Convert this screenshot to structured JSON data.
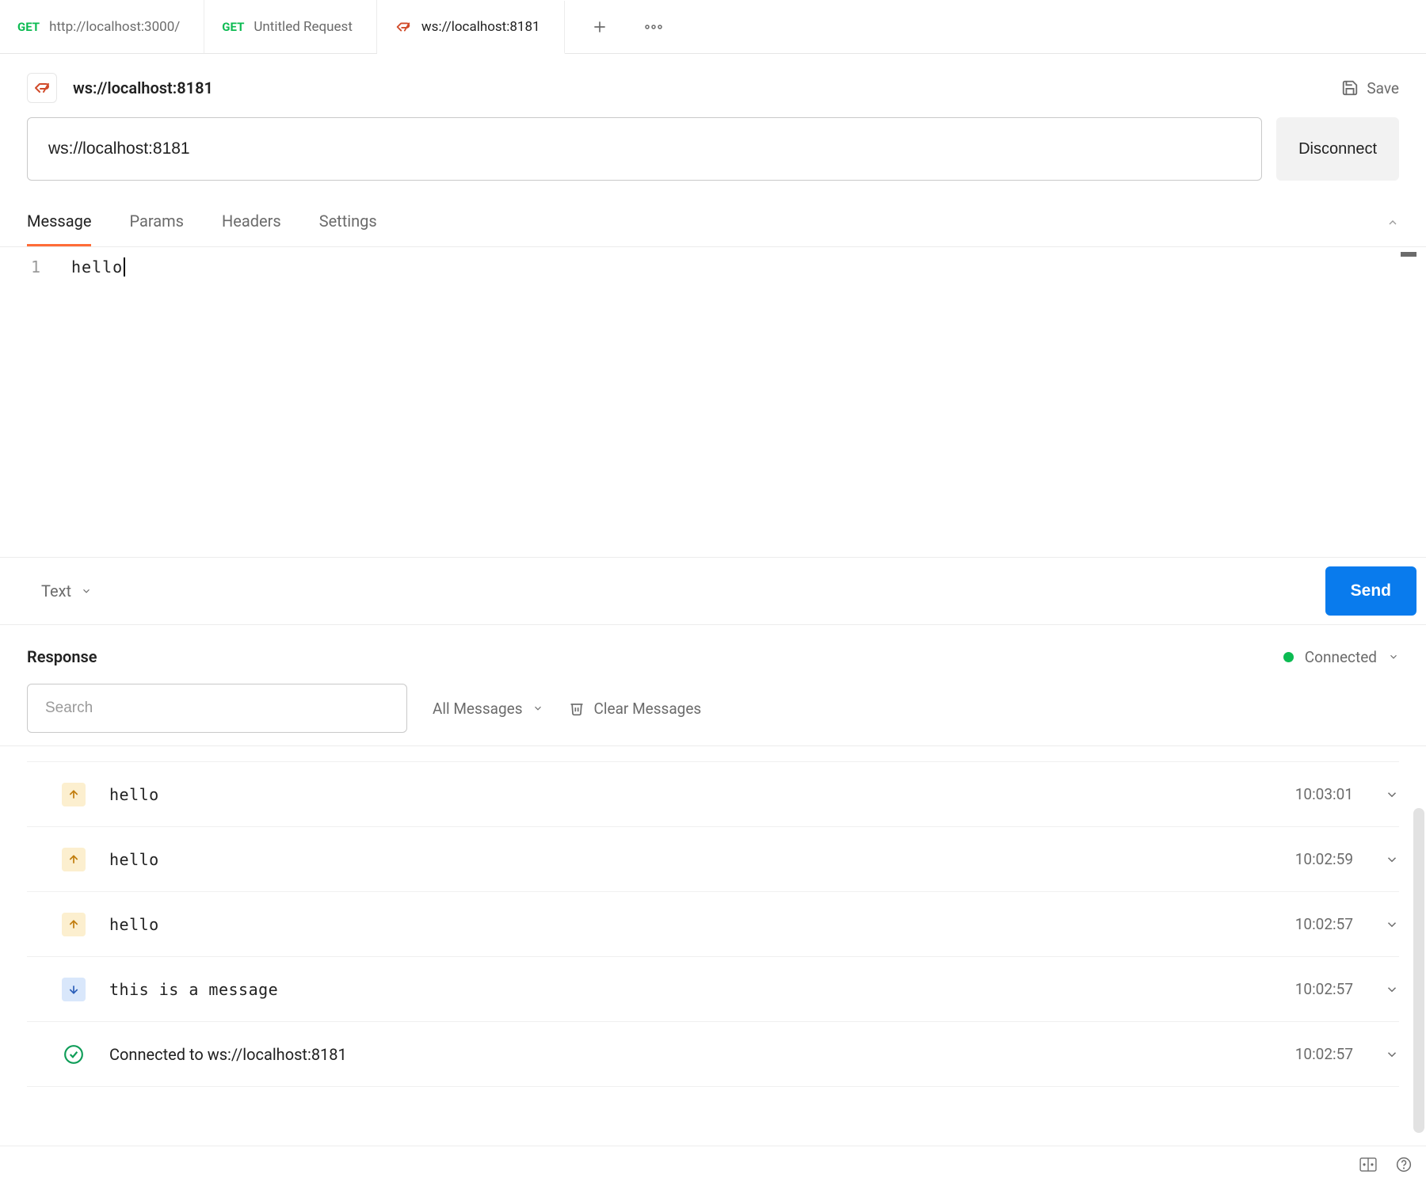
{
  "tabs": [
    {
      "method": "GET",
      "label": "http://localhost:3000/"
    },
    {
      "method": "GET",
      "label": "Untitled Request"
    },
    {
      "kind": "ws",
      "label": "ws://localhost:8181"
    }
  ],
  "request": {
    "name": "ws://localhost:8181",
    "save_label": "Save",
    "url": "ws://localhost:8181",
    "disconnect_label": "Disconnect"
  },
  "subtabs": {
    "items": [
      "Message",
      "Params",
      "Headers",
      "Settings"
    ],
    "active_index": 0
  },
  "editor": {
    "line_number": "1",
    "content": "hello"
  },
  "message_toolbar": {
    "format_label": "Text",
    "send_label": "Send"
  },
  "response": {
    "title": "Response",
    "status_label": "Connected",
    "search_placeholder": "Search",
    "filter_label": "All Messages",
    "clear_label": "Clear Messages",
    "messages": [
      {
        "dir": "up",
        "text": "hello",
        "time": "10:03:01"
      },
      {
        "dir": "up",
        "text": "hello",
        "time": "10:02:59"
      },
      {
        "dir": "up",
        "text": "hello",
        "time": "10:02:57"
      },
      {
        "dir": "down",
        "text": "this is a message",
        "time": "10:02:57"
      },
      {
        "dir": "conn",
        "text": "Connected to ws://localhost:8181",
        "time": "10:02:57"
      }
    ]
  }
}
